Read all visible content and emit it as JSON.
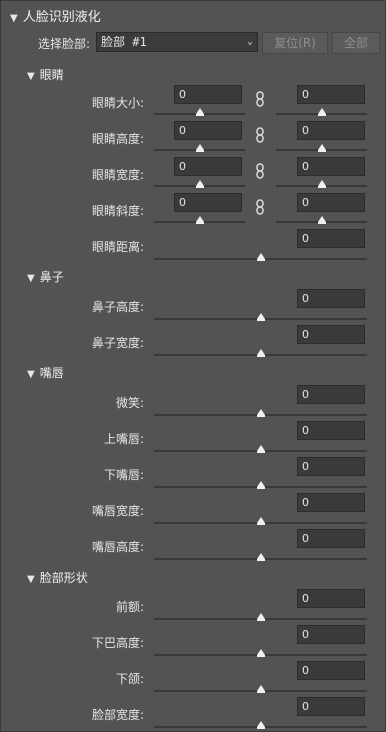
{
  "panel": {
    "title": "人脸识别液化"
  },
  "face_select": {
    "label": "选择脸部:",
    "value": "脸部 #1",
    "reset_label": "复位(R)",
    "all_label": "全部"
  },
  "eyes": {
    "title": "眼睛",
    "size": {
      "label": "眼睛大小:",
      "left": "0",
      "right": "0"
    },
    "height": {
      "label": "眼睛高度:",
      "left": "0",
      "right": "0"
    },
    "width": {
      "label": "眼睛宽度:",
      "left": "0",
      "right": "0"
    },
    "tilt": {
      "label": "眼睛斜度:",
      "left": "0",
      "right": "0"
    },
    "distance": {
      "label": "眼睛距离:",
      "value": "0"
    }
  },
  "nose": {
    "title": "鼻子",
    "height": {
      "label": "鼻子高度:",
      "value": "0"
    },
    "width": {
      "label": "鼻子宽度:",
      "value": "0"
    }
  },
  "mouth": {
    "title": "嘴唇",
    "smile": {
      "label": "微笑:",
      "value": "0"
    },
    "upper_lip": {
      "label": "上嘴唇:",
      "value": "0"
    },
    "lower_lip": {
      "label": "下嘴唇:",
      "value": "0"
    },
    "width": {
      "label": "嘴唇宽度:",
      "value": "0"
    },
    "height": {
      "label": "嘴唇高度:",
      "value": "0"
    }
  },
  "face_shape": {
    "title": "脸部形状",
    "forehead": {
      "label": "前额:",
      "value": "0"
    },
    "chin_height": {
      "label": "下巴高度:",
      "value": "0"
    },
    "jaw": {
      "label": "下颌:",
      "value": "0"
    },
    "face_width": {
      "label": "脸部宽度:",
      "value": "0"
    }
  }
}
